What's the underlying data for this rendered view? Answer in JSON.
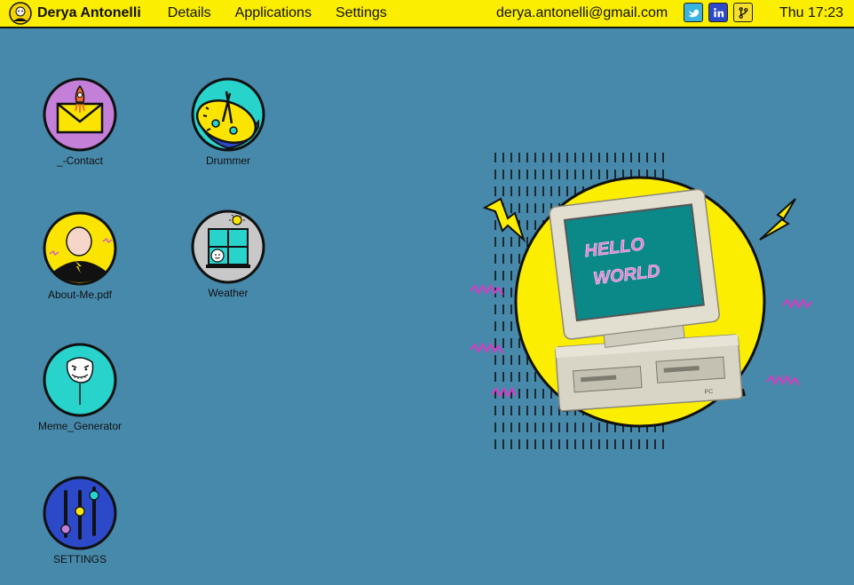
{
  "topbar": {
    "user_name": "Derya Antonelli",
    "menu": [
      "Details",
      "Applications",
      "Settings"
    ],
    "email": "derya.antonelli@gmail.com",
    "social": [
      {
        "icon": "twitter-icon",
        "color": "#3ab3df"
      },
      {
        "icon": "linkedin-icon",
        "color": "#2b49c9"
      },
      {
        "icon": "git-branch-icon",
        "color": "#f5df2c"
      }
    ],
    "clock": "Thu 17:23",
    "background": "#fbee00"
  },
  "desktop": {
    "background": "#4789ab",
    "icons": [
      {
        "label": "_-Contact",
        "icon": "envelope-rocket-icon"
      },
      {
        "label": "Drummer",
        "icon": "drum-icon"
      },
      {
        "label": "About-Me.pdf",
        "icon": "portrait-icon"
      },
      {
        "label": "Weather",
        "icon": "window-sun-icon"
      },
      {
        "label": "Meme_Generator",
        "icon": "troll-face-icon"
      },
      {
        "label": "SETTINGS",
        "icon": "sliders-icon"
      }
    ]
  },
  "illustration": {
    "screen_text": [
      "HELLO",
      "WORLD"
    ],
    "computer_badge": "PC"
  }
}
